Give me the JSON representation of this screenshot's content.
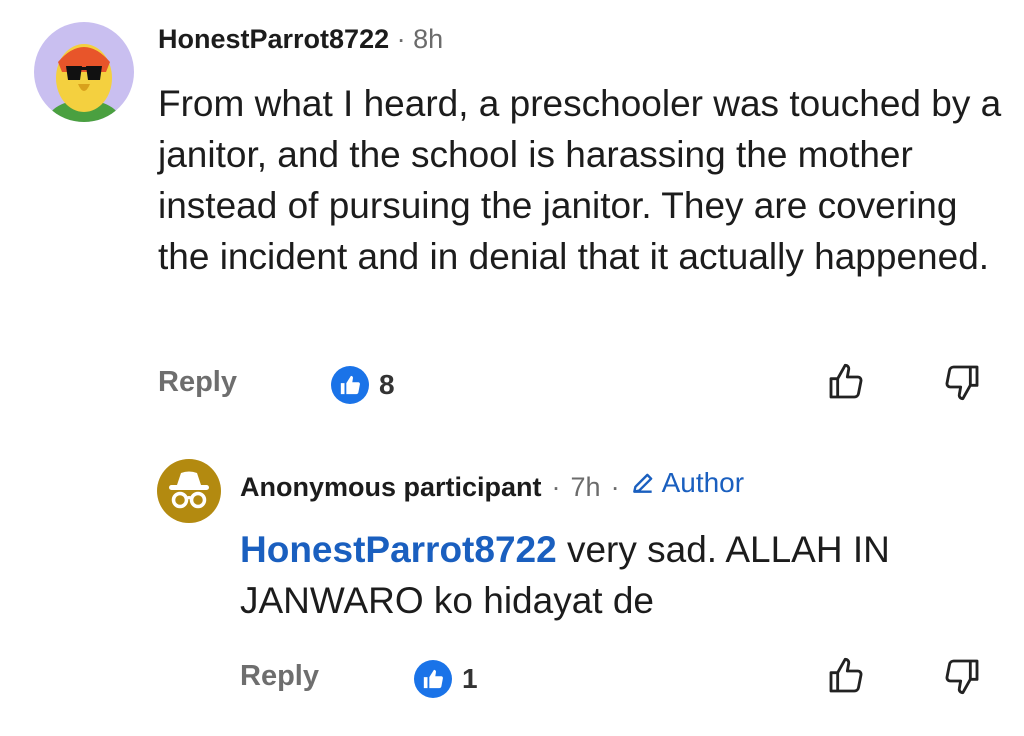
{
  "comment": {
    "username": "HonestParrot8722",
    "separator": "·",
    "time": "8h",
    "avatar_icon": "parrot-sunglasses-avatar",
    "body": "From what I heard, a preschooler was touched by a janitor, and the school is harassing the mother instead of pursuing the janitor. They are covering the incident and in denial that it actually happened.",
    "reply_label": "Reply",
    "like_count": "8",
    "upvote_icon": "thumbs-up-outline-icon",
    "downvote_icon": "thumbs-down-outline-icon"
  },
  "reply": {
    "username": "Anonymous participant",
    "separator": "·",
    "time": "7h",
    "separator2": "·",
    "author_label": "Author",
    "avatar_icon": "incognito-avatar",
    "mention": "HonestParrot8722",
    "body": "very sad. ALLAH IN JANWARO ko hidayat de",
    "reply_label": "Reply",
    "like_count": "1"
  },
  "colors": {
    "accent_blue": "#1a73e8",
    "mention_blue": "#1a5fbf",
    "meta_gray": "#6b6b6b",
    "avatar1_bg": "#c9bff0",
    "avatar2_bg": "#b38a10"
  }
}
